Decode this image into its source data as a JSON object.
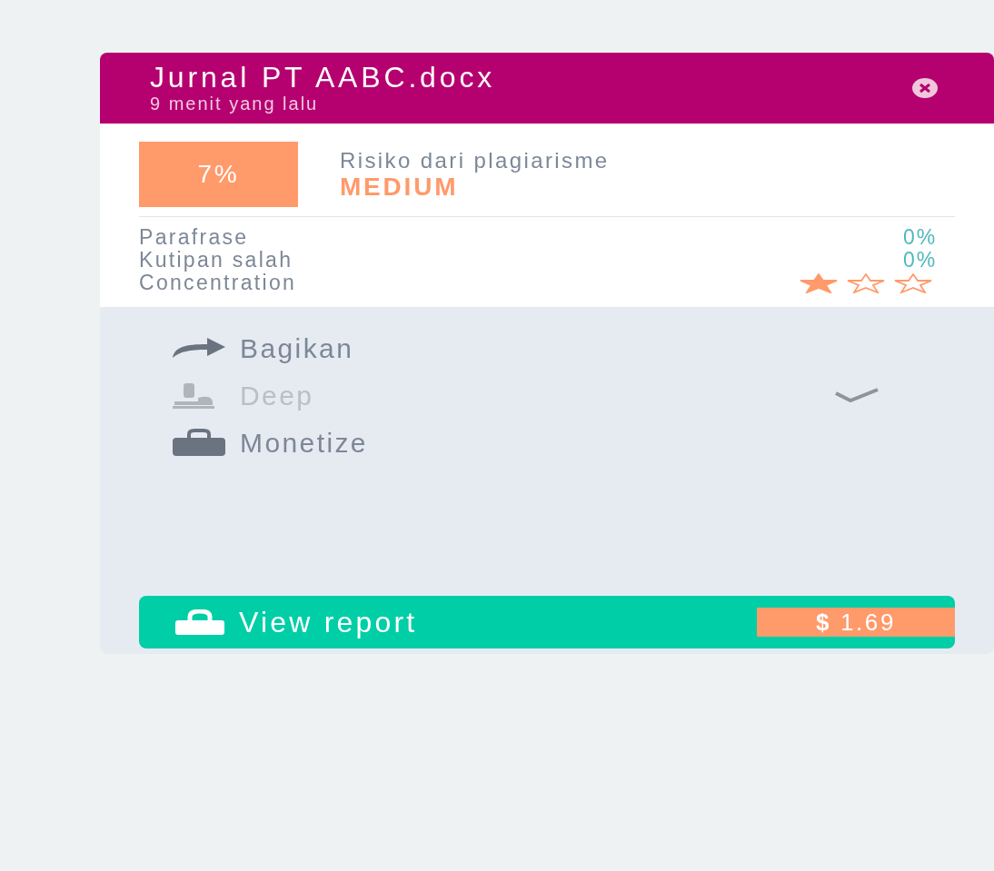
{
  "card": {
    "title": "Jurnal PT AABC.docx",
    "subtitle": "9 menit yang lalu",
    "score": {
      "value": "7%",
      "label": "Risiko dari plagiarisme",
      "level_text": "MEDIUM"
    },
    "metrics": [
      {
        "label": "Parafrase",
        "value": "0%"
      },
      {
        "label": "Kutipan salah",
        "value": "0%"
      }
    ],
    "concentration": {
      "label": "Concentration",
      "stars": 1
    },
    "actions": [
      {
        "kind": "share",
        "label": "Bagikan",
        "disabled": false,
        "checked": false
      },
      {
        "kind": "deep",
        "label": "Deep",
        "disabled": true,
        "checked": true
      },
      {
        "kind": "monetize",
        "label": "Monetize",
        "disabled": false,
        "checked": false
      }
    ],
    "report_button": {
      "label": "View report",
      "price": "**$** 1.69"
    }
  }
}
